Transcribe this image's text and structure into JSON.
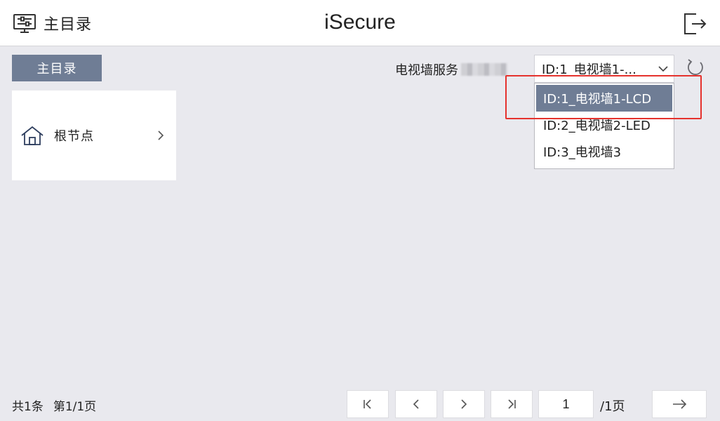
{
  "header": {
    "menu_label": "主目录",
    "title": "iSecure",
    "menu_icon": "menu-control-icon",
    "exit_icon": "logout-icon"
  },
  "breadcrumb": {
    "label": "主目录"
  },
  "videowall": {
    "label": "电视墙服务",
    "selected_value": "ID:1_电视墙1-...",
    "options": [
      "ID:1_电视墙1-LCD",
      "ID:2_电视墙2-LED",
      "ID:3_电视墙3"
    ],
    "selected_index": 0
  },
  "tree": {
    "root_label": "根节点",
    "icon": "home-icon"
  },
  "footer": {
    "total": "共1条",
    "page_info": "第1/1页",
    "current_page": "1",
    "total_pages": "/1页"
  },
  "colors": {
    "accent": "#6f7d95",
    "highlight": "#e5322d",
    "background": "#e9e9ee"
  }
}
